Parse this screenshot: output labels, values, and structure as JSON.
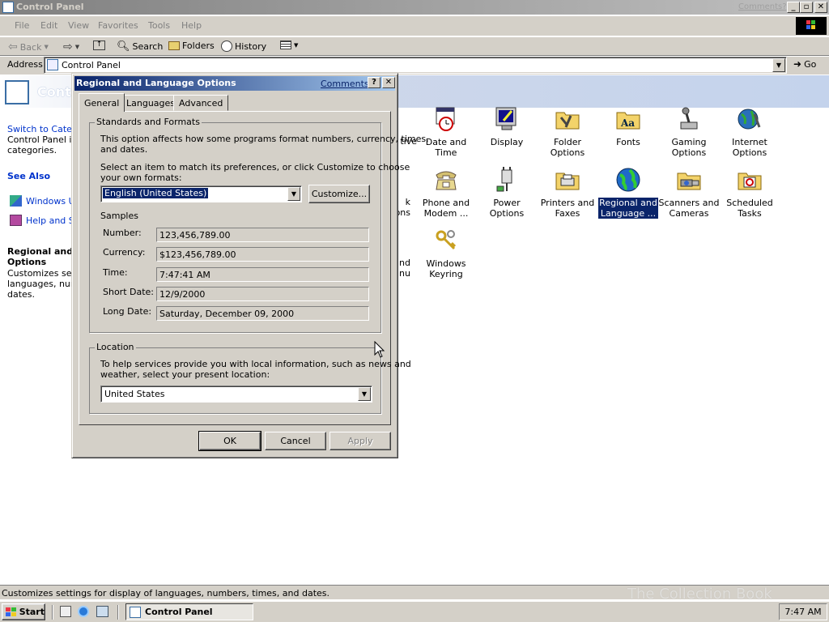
{
  "window": {
    "title": "Control Panel",
    "comments_link": "Comments?",
    "menu": [
      "File",
      "Edit",
      "View",
      "Favorites",
      "Tools",
      "Help"
    ],
    "toolbar": {
      "back": "Back",
      "search": "Search",
      "folders": "Folders",
      "history": "History"
    },
    "address": {
      "label": "Address",
      "value": "Control Panel",
      "go": "Go"
    }
  },
  "left_panel": {
    "title_partial": "Contr",
    "switch_link": "Switch to Catego",
    "description": [
      "Control Panel ico",
      "categories."
    ],
    "see_also": "See Also",
    "links": [
      "Windows Up",
      "Help and Su"
    ],
    "selected_title": [
      "Regional and l",
      "Options"
    ],
    "selected_desc": [
      "Customizes setti",
      "languages, numb",
      "dates."
    ]
  },
  "icons": [
    {
      "label": [
        "tive"
      ],
      "icon": "partial-icon"
    },
    {
      "label": [
        "Date and Time"
      ],
      "icon": "calendar-clock-icon"
    },
    {
      "label": [
        "Display"
      ],
      "icon": "monitor-icon"
    },
    {
      "label": [
        "Folder Options"
      ],
      "icon": "folder-tools-icon"
    },
    {
      "label": [
        "Fonts"
      ],
      "icon": "fonts-folder-icon"
    },
    {
      "label": [
        "Gaming",
        "Options"
      ],
      "icon": "joystick-icon"
    },
    {
      "label": [
        "Internet",
        "Options"
      ],
      "icon": "globe-tools-icon"
    },
    {
      "label": [
        "k",
        "ons"
      ],
      "icon": "partial-icon"
    },
    {
      "label": [
        "Phone and",
        "Modem ..."
      ],
      "icon": "phone-icon"
    },
    {
      "label": [
        "Power Options"
      ],
      "icon": "power-plug-icon"
    },
    {
      "label": [
        "Printers and",
        "Faxes"
      ],
      "icon": "printer-folder-icon"
    },
    {
      "label": [
        "Regional and",
        "Language ..."
      ],
      "icon": "globe-icon",
      "selected": true
    },
    {
      "label": [
        "Scanners and",
        "Cameras"
      ],
      "icon": "scanner-camera-icon"
    },
    {
      "label": [
        "Scheduled",
        "Tasks"
      ],
      "icon": "scheduled-tasks-icon"
    },
    {
      "label": [
        "and",
        "nu"
      ],
      "icon": "partial-icon"
    },
    {
      "label": [
        "Windows",
        "Keyring"
      ],
      "icon": "keyring-icon"
    }
  ],
  "dialog": {
    "title": "Regional and Language Options",
    "comments": "Comments?",
    "help": "?",
    "close": "✕",
    "tabs": [
      "General",
      "Languages",
      "Advanced"
    ],
    "standards": {
      "label": "Standards and Formats",
      "text1": [
        "This option affects how some programs format numbers, currency, times,",
        "and dates."
      ],
      "text2": [
        "Select an item to match its preferences, or click Customize to choose",
        "your own formats:"
      ],
      "selected_format": "English (United States)",
      "customize": "Customize...",
      "samples_label": "Samples",
      "samples": [
        {
          "label": "Number:",
          "value": "123,456,789.00"
        },
        {
          "label": "Currency:",
          "value": "$123,456,789.00"
        },
        {
          "label": "Time:",
          "value": "7:47:41 AM"
        },
        {
          "label": "Short Date:",
          "value": "12/9/2000"
        },
        {
          "label": "Long Date:",
          "value": "Saturday, December 09, 2000"
        }
      ]
    },
    "location": {
      "label": "Location",
      "text": [
        "To help services provide you with local information, such as news and",
        "weather, select your present location:"
      ],
      "value": "United States"
    },
    "buttons": {
      "ok": "OK",
      "cancel": "Cancel",
      "apply": "Apply"
    }
  },
  "status_text": "Customizes settings for display of languages, numbers, times, and dates.",
  "taskbar": {
    "start": "Start",
    "task": "Control Panel",
    "clock": "7:47 AM",
    "watermark": "The Collection Book"
  }
}
